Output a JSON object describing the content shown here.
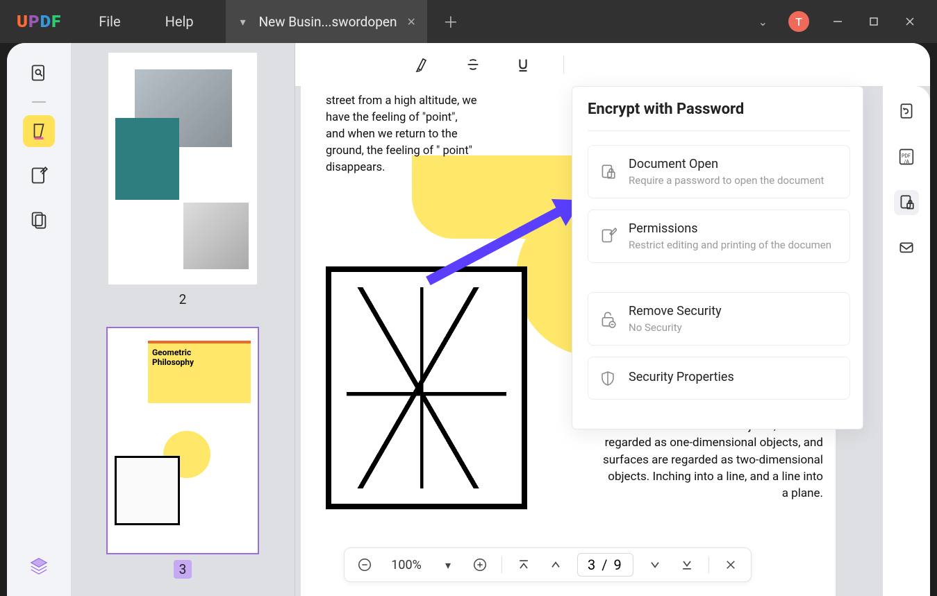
{
  "menu": {
    "file": "File",
    "help": "Help"
  },
  "tab": {
    "title": "New Busin...swordopen"
  },
  "avatar": "T",
  "panel": {
    "title": "Encrypt with Password",
    "docopen": {
      "t": "Document Open",
      "d": "Require a password to open the document"
    },
    "perm": {
      "t": "Permissions",
      "d": "Restrict editing and printing of the documen"
    },
    "remove": {
      "t": "Remove Security",
      "d": "No Security"
    },
    "props": {
      "t": "Security Properties"
    }
  },
  "pages": {
    "p2": "2",
    "p3": "3"
  },
  "thumb3": {
    "title": "Geometric\nPhilosophy"
  },
  "doc": {
    "left": "street from a high altitude, we have the feeling of \"point\", and when we return to the ground, the feeling of \" point\" disappears.",
    "right": "the most basic component in geometry. In the usual sense, points are regarded as zero-dimensional objects, lines are regarded as one-dimensional objects, and surfaces are regarded as two-dimensional objects. Inching into a line, and a line into a plane."
  },
  "bottombar": {
    "zoom": "100%",
    "page_current": "3",
    "page_sep": "/",
    "page_total": "9"
  }
}
